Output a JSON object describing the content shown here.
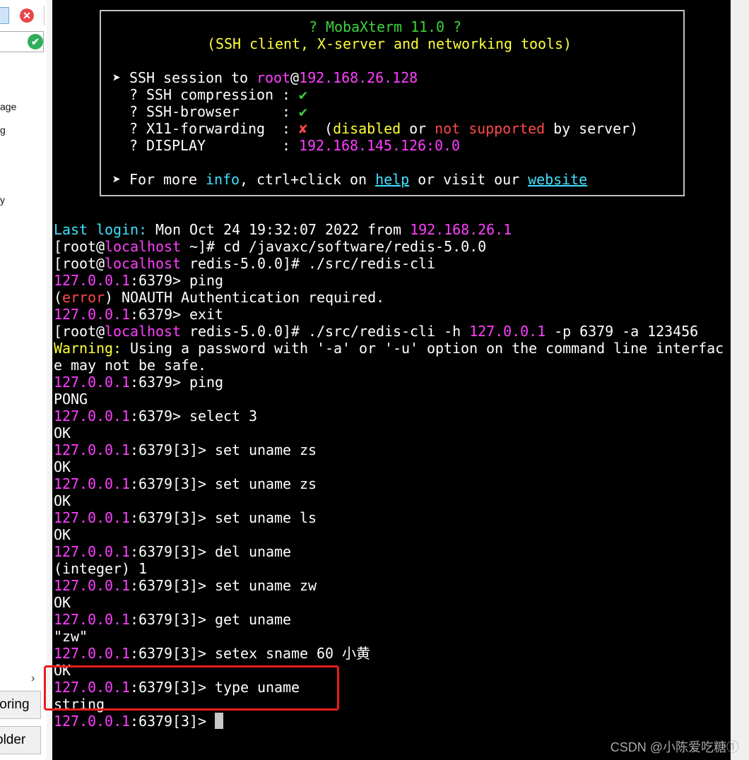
{
  "sidebar": {
    "close_glyph": "✕",
    "filter_ok_glyph": "✔",
    "partial_items": [
      "age",
      "g",
      "y"
    ],
    "scroll_glyph": "›",
    "tabs": [
      {
        "label": "toring"
      },
      {
        "label": "older"
      }
    ]
  },
  "banner": {
    "title": "? MobaXterm 11.0 ?",
    "subtitle": "(SSH client, X-server and networking tools)",
    "session_prefix": "➤ SSH session to ",
    "session_user": "root",
    "session_at": "@",
    "session_host": "192.168.26.128",
    "compression_label": "  ? SSH compression : ",
    "browser_label": "  ? SSH-browser     : ",
    "x11_label": "  ? X11-forwarding  : ",
    "display_label": "  ? DISPLAY         : ",
    "check_glyph": "✔",
    "cross_glyph": "✘",
    "x11_p1": "  (",
    "x11_disabled": "disabled",
    "x11_or": " or ",
    "x11_not_supported": "not supported",
    "x11_by": " by server)",
    "display_value": "192.168.145.126:0.0",
    "info_prefix": "➤ For more ",
    "info_word": "info",
    "info_mid": ", ctrl+click on ",
    "help_link": "help",
    "info_or": " or visit our ",
    "website_link": "website"
  },
  "terminal": {
    "last_login_label": "Last login:",
    "last_login_text": " Mon Oct 24 19:32:07 2022 from ",
    "last_login_ip": "192.168.26.1",
    "prompt_open": "[root@",
    "prompt_host": "localhost",
    "cmd1": " ~]# cd /javaxc/software/redis-5.0.0",
    "cmd2": " redis-5.0.0]# ./src/redis-cli",
    "redis_host": "127.0.0.1",
    "redis_port": ":6379> ",
    "redis_port_db": ":6379[3]> ",
    "ping": "ping",
    "error_open": "(",
    "error_word": "error",
    "error_rest": ") NOAUTH Authentication required.",
    "exit": "exit",
    "cmd3_a": " redis-5.0.0]# ./src/redis-cli -h ",
    "cmd3_b": " -p 6379 -a 123456",
    "warning_label": "Warning:",
    "warning_text": " Using a password with '-a' or '-u' option on the command line interfac",
    "warning_text2": "e may not be safe.",
    "pong": "PONG",
    "select": "select 3",
    "ok": "OK",
    "set_zs": "set uname zs",
    "set_ls": "set uname ls",
    "del": "del uname",
    "integer": "(integer) 1",
    "set_zw": "set uname zw",
    "get": "get uname",
    "zw": "\"zw\"",
    "setex": "setex sname 60 小黄",
    "type": "type uname",
    "string": "string"
  },
  "watermark": "CSDN @小陈爱吃糖①"
}
